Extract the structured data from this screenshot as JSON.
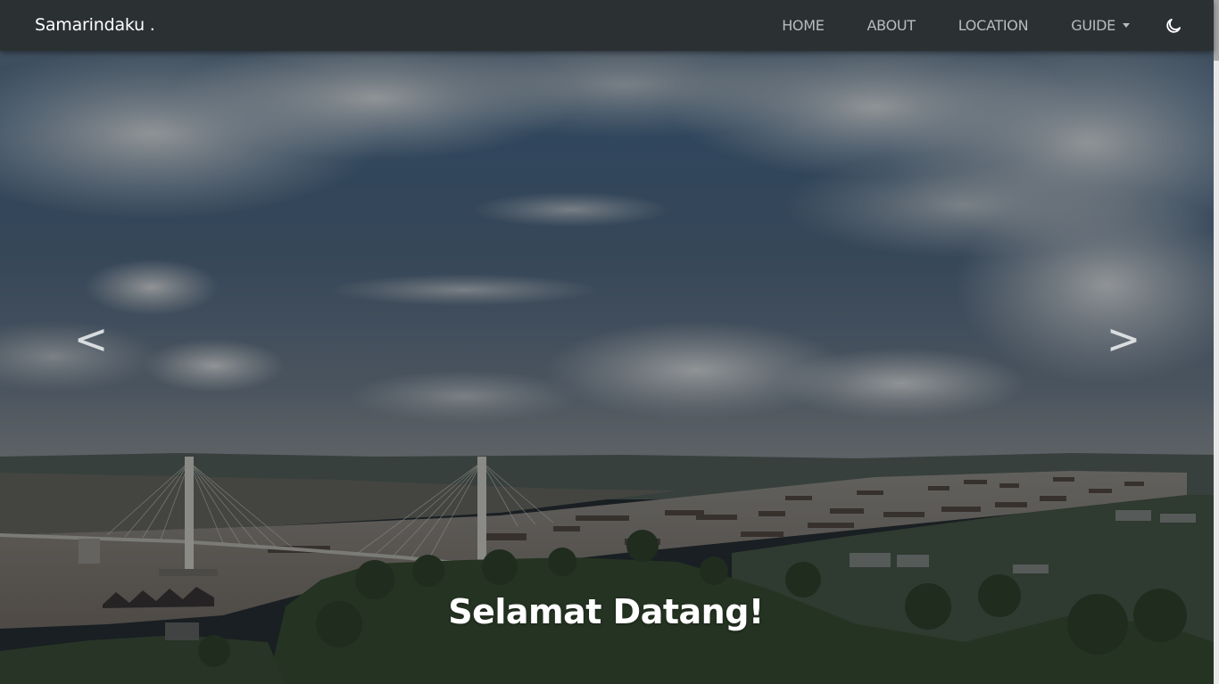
{
  "navbar": {
    "brand": "Samarindaku .",
    "links": [
      {
        "label": "HOME"
      },
      {
        "label": "ABOUT"
      },
      {
        "label": "LOCATION"
      }
    ],
    "dropdown": {
      "label": "GUIDE",
      "icon": "chevron-down-icon"
    },
    "theme_toggle_icon": "moon-icon"
  },
  "carousel": {
    "prev_label": "<",
    "next_label": ">",
    "caption_title": "Selamat Datang!"
  },
  "colors": {
    "navbar_bg": "#2b3033",
    "nav_link": "#b9bcbe",
    "brand": "#ffffff",
    "caption": "#ffffff"
  }
}
